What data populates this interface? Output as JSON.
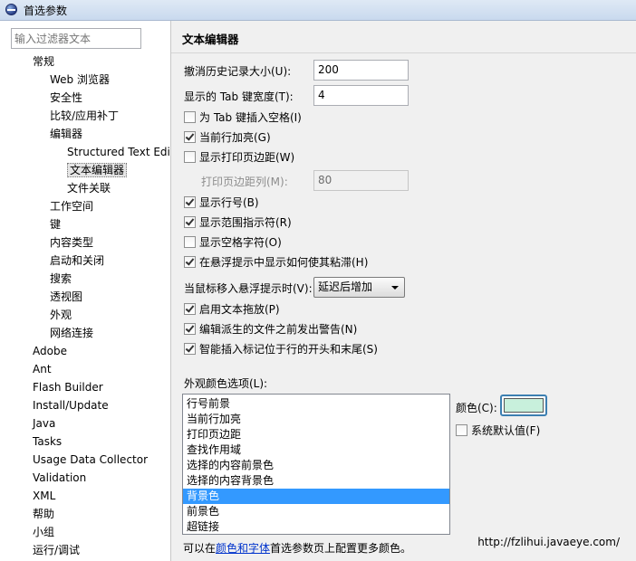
{
  "window": {
    "title": "首选参数"
  },
  "filter": {
    "placeholder": "输入过滤器文本"
  },
  "tree": [
    {
      "label": "常规",
      "level": 1
    },
    {
      "label": "Web 浏览器",
      "level": 2
    },
    {
      "label": "安全性",
      "level": 2
    },
    {
      "label": "比较/应用补丁",
      "level": 2
    },
    {
      "label": "编辑器",
      "level": 2
    },
    {
      "label": "Structured Text Edi",
      "level": 3
    },
    {
      "label": "文本编辑器",
      "level": 3,
      "selected": true
    },
    {
      "label": "文件关联",
      "level": 3
    },
    {
      "label": "工作空间",
      "level": 2
    },
    {
      "label": "键",
      "level": 2
    },
    {
      "label": "内容类型",
      "level": 2
    },
    {
      "label": "启动和关闭",
      "level": 2
    },
    {
      "label": "搜索",
      "level": 2
    },
    {
      "label": "透视图",
      "level": 2
    },
    {
      "label": "外观",
      "level": 2
    },
    {
      "label": "网络连接",
      "level": 2
    },
    {
      "label": "Adobe",
      "level": 1
    },
    {
      "label": "Ant",
      "level": 1
    },
    {
      "label": "Flash Builder",
      "level": 1
    },
    {
      "label": "Install/Update",
      "level": 1
    },
    {
      "label": "Java",
      "level": 1
    },
    {
      "label": "Tasks",
      "level": 1
    },
    {
      "label": "Usage Data Collector",
      "level": 1
    },
    {
      "label": "Validation",
      "level": 1
    },
    {
      "label": "XML",
      "level": 1
    },
    {
      "label": "帮助",
      "level": 1
    },
    {
      "label": "小组",
      "level": 1
    },
    {
      "label": "运行/调试",
      "level": 1
    }
  ],
  "page": {
    "title": "文本编辑器",
    "undo_label": "撤消历史记录大小(U):",
    "undo_value": "200",
    "tab_width_label": "显示的 Tab 键宽度(T):",
    "tab_width_value": "4",
    "margin_col_label": "打印页边距列(M):",
    "margin_col_value": "80",
    "hover_label": "当鼠标移入悬浮提示时(V):",
    "hover_value": "延迟后增加",
    "checkboxes_a": [
      {
        "label": "为 Tab 键插入空格(I)",
        "checked": false
      },
      {
        "label": "当前行加亮(G)",
        "checked": true
      },
      {
        "label": "显示打印页边距(W)",
        "checked": false
      }
    ],
    "checkboxes_b": [
      {
        "label": "显示行号(B)",
        "checked": true
      },
      {
        "label": "显示范围指示符(R)",
        "checked": true
      },
      {
        "label": "显示空格字符(O)",
        "checked": false
      },
      {
        "label": "在悬浮提示中显示如何使其粘滞(H)",
        "checked": true
      }
    ],
    "checkboxes_c": [
      {
        "label": "启用文本拖放(P)",
        "checked": true
      },
      {
        "label": "编辑派生的文件之前发出警告(N)",
        "checked": true
      },
      {
        "label": "智能插入标记位于行的开头和末尾(S)",
        "checked": true
      }
    ],
    "appearance_label": "外观颜色选项(L):",
    "appearance_items": [
      "行号前景",
      "当前行加亮",
      "打印页边距",
      "查找作用域",
      "选择的内容前景色",
      "选择的内容背景色",
      "背景色",
      "前景色",
      "超链接"
    ],
    "appearance_selected": 6,
    "color_label": "颜色(C):",
    "color_value": "#c8f0dc",
    "system_default_label": "系统默认值(F)",
    "system_default_checked": false,
    "footer_prefix": "可以在",
    "footer_link": "颜色和字体",
    "footer_suffix": "首选参数页上配置更多颜色。"
  },
  "watermark": "http://fzlihui.javaeye.com/"
}
